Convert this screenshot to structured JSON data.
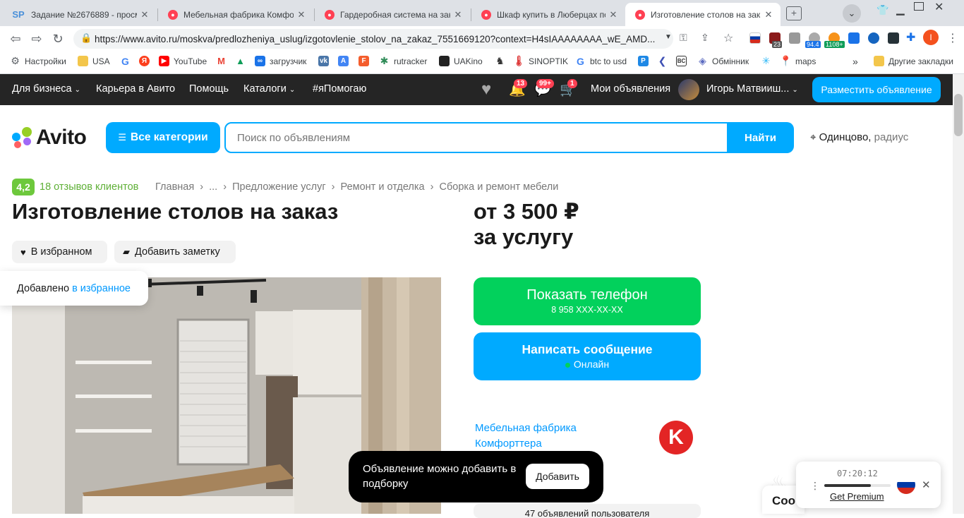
{
  "browser": {
    "tabs": [
      {
        "title": "Задание №2676889 - просмот",
        "fav_text": "SP",
        "fav_color": "#4a90d9"
      },
      {
        "title": "Мебельная фабрика Комфорт",
        "fav_text": "",
        "fav_color": "#ff4053"
      },
      {
        "title": "Гардеробная система на заказ",
        "fav_text": "",
        "fav_color": "#ff4053"
      },
      {
        "title": "Шкаф купить в Люберцах по",
        "fav_text": "",
        "fav_color": "#ff4053"
      },
      {
        "title": "Изготовление столов на заказ",
        "fav_text": "",
        "fav_color": "#ff4053"
      }
    ],
    "url": "https://www.avito.ru/moskva/predlozheniya_uslug/izgotovlenie_stolov_na_zakaz_7551669120?context=H4sIAAAAAAAA_wE_AMD...",
    "extensions": {
      "badge_23": "23",
      "badge_94": "94.4",
      "badge_1108": "1108+",
      "profile_letter": "I"
    },
    "bookmarks": [
      {
        "label": "Настройки",
        "icon": "gear-icon",
        "color": "#5f6368"
      },
      {
        "label": "USA",
        "icon": "folder-icon",
        "color": "#f3c64b"
      },
      {
        "label": "",
        "icon": "google-icon",
        "color": "#4285f4"
      },
      {
        "label": "",
        "icon": "yandex-icon",
        "color": "#fc3f1d"
      },
      {
        "label": "YouTube",
        "icon": "youtube-icon",
        "color": "#ff0000"
      },
      {
        "label": "",
        "icon": "gmail-icon",
        "color": "#ea4335"
      },
      {
        "label": "",
        "icon": "drive-icon",
        "color": "#0f9d58"
      },
      {
        "label": "загрузчик",
        "icon": "infinity-icon",
        "color": "#1a73e8"
      },
      {
        "label": "",
        "icon": "vk-icon",
        "color": "#4a76a8"
      },
      {
        "label": "",
        "icon": "translate-icon",
        "color": "#4285f4"
      },
      {
        "label": "",
        "icon": "f-icon",
        "color": "#f45d2c"
      },
      {
        "label": "rutracker",
        "icon": "rutracker-icon",
        "color": "#2e8b57"
      },
      {
        "label": "UAKino",
        "icon": "uakino-icon",
        "color": "#222"
      },
      {
        "label": "",
        "icon": "chess-icon",
        "color": "#333"
      },
      {
        "label": "SINOPTIK",
        "icon": "thermometer-icon",
        "color": "#d33"
      },
      {
        "label": "btc to usd",
        "icon": "google-icon",
        "color": "#4285f4"
      },
      {
        "label": "",
        "icon": "p-icon",
        "color": "#1e88e5"
      },
      {
        "label": "",
        "icon": "arrow-icon",
        "color": "#3f51b5"
      },
      {
        "label": "",
        "icon": "bc-icon",
        "color": "#333"
      },
      {
        "label": "Обмінник",
        "icon": "diamond-icon",
        "color": "#5c6bc0"
      },
      {
        "label": "",
        "icon": "star-icon",
        "color": "#29b6f6"
      },
      {
        "label": "maps",
        "icon": "maps-icon",
        "color": "#34a853"
      },
      {
        "label": "Другие закладки",
        "icon": "folder-icon",
        "color": "#f3c64b"
      }
    ],
    "bookmarks_more": "»"
  },
  "topbar": {
    "business": "Для бизнеса",
    "career": "Карьера в Авито",
    "help": "Помощь",
    "catalogs": "Каталоги",
    "help_tag": "#яПомогаю",
    "notif_count": "13",
    "msg_count": "99+",
    "cart_count": "1",
    "my_ads": "Мои объявления",
    "user_name": "Игорь Матвииш...",
    "post_ad": "Разместить объявление"
  },
  "header": {
    "logo_text": "Avito",
    "categories": "Все категории",
    "search_placeholder": "Поиск по объявлениям",
    "find": "Найти",
    "location_city": "Одинцово,",
    "location_radius": "радиус"
  },
  "breadcrumbs": {
    "rating": "4,2",
    "reviews": "18 отзывов клиентов",
    "items": [
      "Главная",
      "›",
      "...",
      "›",
      "Предложение услуг",
      "›",
      "Ремонт и отделка",
      "›",
      "Сборка и ремонт мебели"
    ]
  },
  "listing": {
    "title": "Изготовление столов на заказ",
    "price_line1": "от 3 500 ₽",
    "price_line2": "за услугу",
    "fav_label": "В избранном",
    "note_label": "Добавить заметку",
    "toast_prefix": "Добавлено",
    "toast_link": "в избранное"
  },
  "contact": {
    "phone_label": "Показать телефон",
    "phone_number": "8 958 XXX-XX-XX",
    "message_label": "Написать сообщение",
    "online_label": "Онлайн",
    "seller_name": "Мебельная фабрика Комфорттера",
    "seller_logo": "K",
    "seller_extra": "а",
    "more_ads": "47 объявлений пользователя"
  },
  "bottom_toast": {
    "text": "Объявление можно добавить в подборку",
    "button": "Добавить"
  },
  "chat_peek": "Соо",
  "timer_widget": {
    "time": "07:20:12",
    "premium": "Get Premium",
    "progress": 0.7
  },
  "colors": {
    "avito_blue": "#00aaff",
    "phone_green": "#02d15c",
    "rating_green": "#6dc83c",
    "badge_red": "#ff4053"
  }
}
